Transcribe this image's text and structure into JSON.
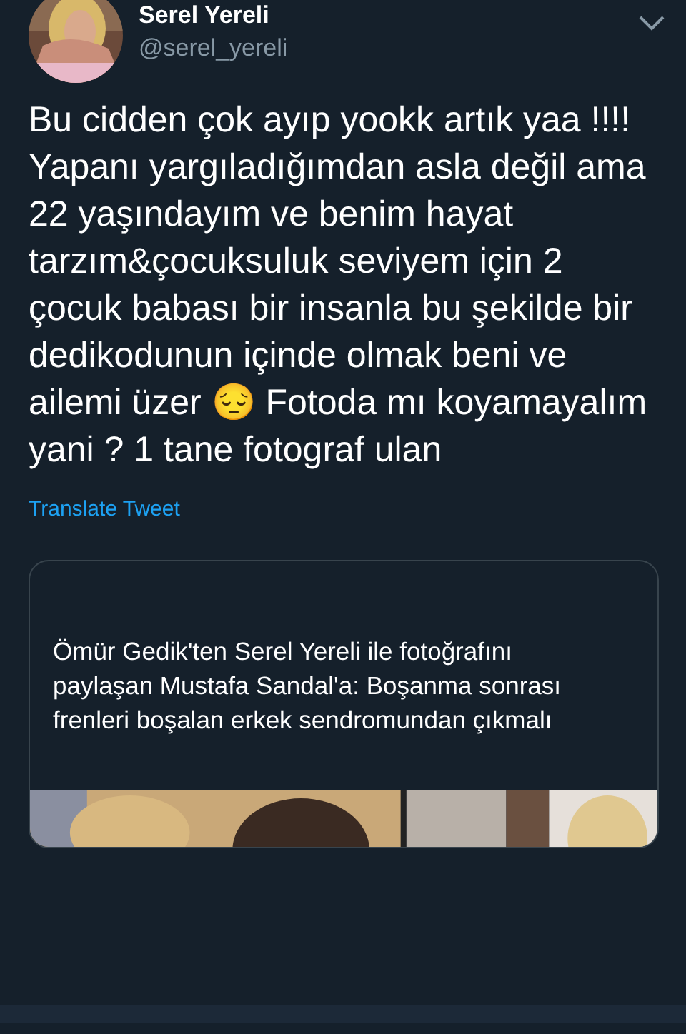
{
  "tweet": {
    "author": {
      "name": "Serel Yereli",
      "handle": "@serel_yereli"
    },
    "text": "Bu cidden çok ayıp yookk artık yaa !!!! Yapanı yargıladığımdan asla değil ama 22 yaşındayım ve benim hayat tarzım&çocuksuluk seviyem için 2 çocuk babası bir insanla bu şekilde bir dedikodunun içinde olmak beni ve ailemi üzer 😔 Fotoda mı koyamayalım yani ? 1 tane fotograf ulan",
    "translate_link": "Translate Tweet",
    "link_card": {
      "title": "Ömür Gedik'ten Serel Yereli ile fotoğrafını paylaşan Mustafa Sandal'a: Boşanma sonrası frenleri boşalan erkek sendromundan çıkmalı"
    }
  }
}
